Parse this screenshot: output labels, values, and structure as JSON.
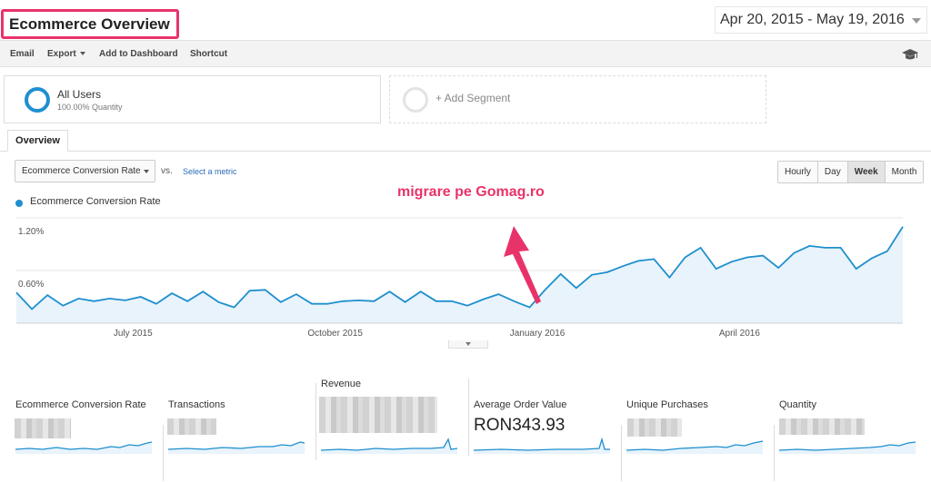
{
  "page": {
    "title": "Ecommerce Overview",
    "date_range": "Apr 20, 2015 - May 19, 2016"
  },
  "toolbar": {
    "email": "Email",
    "export": "Export",
    "add_to_dashboard": "Add to Dashboard",
    "shortcut": "Shortcut",
    "icon": "graduation-cap-icon"
  },
  "segments": {
    "all_users": {
      "name": "All Users",
      "sub": "100.00% Quantity"
    },
    "add_segment": "+ Add Segment"
  },
  "tabs": [
    {
      "label": "Overview"
    }
  ],
  "controls": {
    "metric": "Ecommerce Conversion Rate",
    "vs": "vs.",
    "select_metric": "Select a metric",
    "granularity": [
      {
        "label": "Hourly",
        "active": false
      },
      {
        "label": "Day",
        "active": false
      },
      {
        "label": "Week",
        "active": true
      },
      {
        "label": "Month",
        "active": false
      }
    ]
  },
  "annotation": "migrare pe Gomag.ro",
  "colors": {
    "series": "#1e8fce",
    "fill": "#e8f3fb",
    "accent": "#e8336a"
  },
  "chart_data": {
    "type": "area",
    "legend": [
      "Ecommerce Conversion Rate"
    ],
    "y_ticks": [
      "1.20%",
      "0.60%"
    ],
    "y_tick_values": [
      1.2,
      0.6
    ],
    "ylim": [
      0,
      1.2
    ],
    "x_tick_labels": [
      "July 2015",
      "October 2015",
      "January 2016",
      "April 2016"
    ],
    "x_tick_index": [
      7.5,
      20.5,
      33.5,
      46.5
    ],
    "series": [
      {
        "name": "Ecommerce Conversion Rate",
        "values": [
          0.35,
          0.16,
          0.32,
          0.2,
          0.28,
          0.25,
          0.28,
          0.26,
          0.3,
          0.22,
          0.34,
          0.25,
          0.36,
          0.24,
          0.18,
          0.37,
          0.38,
          0.24,
          0.33,
          0.22,
          0.22,
          0.25,
          0.26,
          0.25,
          0.36,
          0.24,
          0.36,
          0.25,
          0.25,
          0.2,
          0.27,
          0.33,
          0.25,
          0.18,
          0.38,
          0.56,
          0.4,
          0.55,
          0.58,
          0.65,
          0.71,
          0.73,
          0.52,
          0.75,
          0.86,
          0.62,
          0.7,
          0.75,
          0.77,
          0.63,
          0.8,
          0.88,
          0.86,
          0.86,
          0.62,
          0.74,
          0.82,
          1.1
        ]
      }
    ]
  },
  "kpis": [
    {
      "label": "Ecommerce Conversion Rate",
      "value": ""
    },
    {
      "label": "Transactions",
      "value": ""
    },
    {
      "label": "Revenue",
      "value": ""
    },
    {
      "label": "Average Order Value",
      "value": "RON343.93"
    },
    {
      "label": "Unique Purchases",
      "value": ""
    },
    {
      "label": "Quantity",
      "value": ""
    }
  ]
}
